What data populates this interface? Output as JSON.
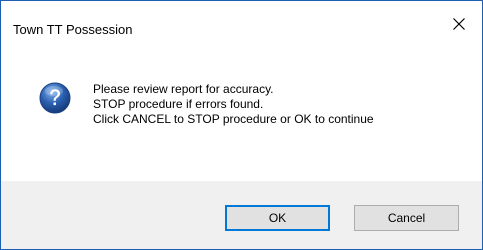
{
  "window": {
    "title": "Town TT Possession",
    "close_icon": "close-icon"
  },
  "message": {
    "icon": "question-icon",
    "lines": [
      "Please review report for accuracy.",
      "STOP procedure if errors found.",
      "Click CANCEL to STOP procedure or OK to continue"
    ]
  },
  "buttons": {
    "ok_label": "OK",
    "cancel_label": "Cancel"
  },
  "colors": {
    "accent": "#0078d7",
    "border": "#1e5fb4",
    "footer_bg": "#f0f0f0",
    "icon_blue": "#2a5fb0"
  }
}
